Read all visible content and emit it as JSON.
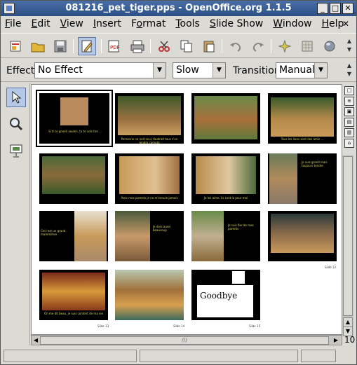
{
  "window": {
    "title": "081216_pet_tiger.pps - OpenOffice.org 1.1.5",
    "min_glyph": "_",
    "max_glyph": "□",
    "close_glyph": "✕"
  },
  "menu": {
    "items": [
      {
        "pre": "",
        "key": "F",
        "post": "ile"
      },
      {
        "pre": "",
        "key": "E",
        "post": "dit"
      },
      {
        "pre": "",
        "key": "V",
        "post": "iew"
      },
      {
        "pre": "",
        "key": "I",
        "post": "nsert"
      },
      {
        "pre": "F",
        "key": "o",
        "post": "rmat"
      },
      {
        "pre": "",
        "key": "T",
        "post": "ools"
      },
      {
        "pre": "",
        "key": "S",
        "post": "lide Show"
      },
      {
        "pre": "",
        "key": "W",
        "post": "indow"
      },
      {
        "pre": "",
        "key": "H",
        "post": "elp"
      }
    ],
    "close_glyph": "✕"
  },
  "toolbar": {
    "icons": [
      "new-icon",
      "open-icon",
      "save-icon",
      "edit-file-icon",
      "export-pdf-icon",
      "print-icon",
      "cut-icon",
      "copy-icon",
      "paste-icon",
      "undo-icon",
      "redo-icon",
      "star-icon",
      "grid-icon",
      "sphere-icon"
    ],
    "pdf_label": "PDF"
  },
  "transition": {
    "effect_label": "Effect",
    "effect_value": "No Effect",
    "speed_value": "Slow",
    "transition_label": "Transition",
    "transition_value": "Manual"
  },
  "slides": [
    {
      "caption": "Si ti ce gnesti seulen, tu te vols tire ...",
      "slide_no": ""
    },
    {
      "caption": "Personne ne nait seul, faudrait tous s'en rendre compte",
      "slide_no": ""
    },
    {
      "caption": "",
      "slide_no": ""
    },
    {
      "caption": "Tous les lions sont des amis ...",
      "slide_no": ""
    },
    {
      "caption": "",
      "slide_no": ""
    },
    {
      "caption": "Avec mes parents je ne m'ennuie jamais",
      "slide_no": ""
    },
    {
      "caption": "Je les aime, ils sont la pour moi",
      "slide_no": ""
    },
    {
      "caption": "Je suis grand mais toujours tendre",
      "slide_no": ""
    },
    {
      "caption": "Ceci est un grand mammifere",
      "slide_no": ""
    },
    {
      "caption": "Je dors aussi beaucoup",
      "slide_no": ""
    },
    {
      "caption": "Je suis fier de mes parents",
      "slide_no": ""
    },
    {
      "caption": "",
      "slide_no": "Slide 12"
    },
    {
      "caption": "On me dit beau, je suis content de ma vie",
      "slide_no": "Slide 13"
    },
    {
      "caption": "",
      "slide_no": "Slide 14"
    },
    {
      "caption": "Goodbye",
      "slide_no": "Slide 15"
    }
  ],
  "status": {
    "zoom_text": "10"
  }
}
